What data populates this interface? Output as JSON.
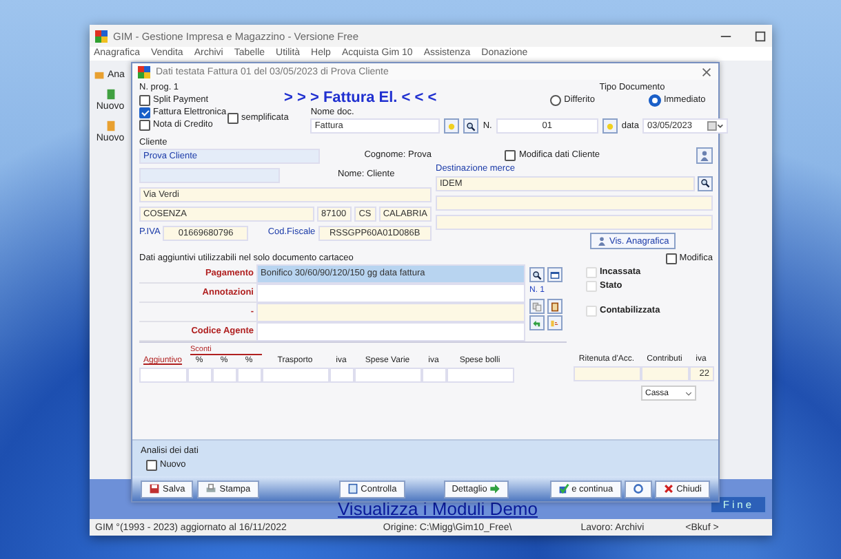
{
  "main_window": {
    "title": "GIM  - Gestione Impresa e Magazzino - Versione Free",
    "menu": [
      "Anagrafica",
      "Vendita",
      "Archivi",
      "Tabelle",
      "Utilità",
      "Help",
      "Acquista Gim 10",
      "Assistenza",
      "Donazione"
    ],
    "toolbar": [
      "Ana",
      "Nuovo",
      "Nuovo"
    ],
    "demo_link": "Visualizza i Moduli Demo",
    "fine_button": "Fine",
    "status_bar": [
      "GIM °(1993 - 2023)  aggiornato al 16/11/2022",
      "Origine: C:\\Migg\\Gim10_Free\\",
      "Lavoro:  Archivi",
      "<Bkuf >"
    ]
  },
  "dialog": {
    "title": "Dati testata Fattura 01 del 03/05/2023 di Prova Cliente",
    "prog": "N. prog. 1",
    "heading": "> > > Fattura El. < < <",
    "options": [
      {
        "label": "Split Payment",
        "checked": false
      },
      {
        "label": "Fattura Elettronica",
        "checked": true
      },
      {
        "label": "Nota di Credito",
        "checked": false
      }
    ],
    "semplificata": {
      "label": "semplificata",
      "checked": false
    },
    "tipo_documento": {
      "label": "Tipo Documento",
      "options": [
        {
          "label": "Differito",
          "selected": false
        },
        {
          "label": "Immediato",
          "selected": true
        }
      ]
    },
    "nome_doc": {
      "label": "Nome doc.",
      "value": "Fattura"
    },
    "numero": {
      "label": "N.",
      "value": "01"
    },
    "data": {
      "label": "data",
      "value": "03/05/2023"
    },
    "cliente": {
      "label": "Cliente",
      "name": "Prova Cliente",
      "cognome": "Cognome: Prova",
      "nome": "Nome: Cliente",
      "modifica": {
        "label": "Modifica dati Cliente",
        "checked": false
      },
      "address": "Via Verdi",
      "city": "COSENZA",
      "cap": "87100",
      "province": "CS",
      "region": "CALABRIA",
      "piva_label": "P.IVA",
      "piva": "01669680796",
      "cf_label": "Cod.Fiscale",
      "cf": "RSSGPP60A01D086B",
      "vis_button": "Vis. Anagrafica"
    },
    "destinazione": {
      "label": "Destinazione merce",
      "value": "IDEM"
    },
    "extra": {
      "caption": "Dati aggiuntivi utilizzabili nel solo documento cartaceo",
      "modifica": {
        "label": "Modifica",
        "checked": false
      },
      "fields": [
        {
          "label": "Pagamento",
          "value": "Bonifico 30/60/90/120/150 gg data fattura",
          "kind": "highlighted"
        },
        {
          "label": "Annotazioni",
          "kind": "plain"
        },
        {
          "label": "-",
          "kind": "tinted"
        },
        {
          "label": "Codice Agente",
          "kind": "plain"
        }
      ],
      "note_count": "N. 1",
      "flags": [
        {
          "label": "Incassata",
          "checked": false
        },
        {
          "label": "Stato",
          "checked": false
        },
        {
          "label": "Contabilizzata",
          "checked": false
        }
      ]
    },
    "charges": {
      "sconti_label": "Sconti",
      "columns": [
        {
          "label": "Aggiuntivo",
          "kind": "link"
        },
        {
          "label": "%",
          "kind": "narrow"
        },
        {
          "label": "%",
          "kind": "narrow"
        },
        {
          "label": "%",
          "kind": "narrow"
        },
        {
          "label": "Trasporto",
          "kind": "wide"
        },
        {
          "label": "iva",
          "kind": "narrow"
        },
        {
          "label": "Spese Varie",
          "kind": "wide"
        },
        {
          "label": "iva",
          "kind": "narrow"
        },
        {
          "label": "Spese bolli",
          "kind": "wide"
        }
      ],
      "right_columns": [
        {
          "label": "Ritenuta d'Acc.",
          "kind": "wide"
        },
        {
          "label": "Contributi",
          "kind": "mid"
        },
        {
          "label": "iva",
          "kind": "narrow",
          "value": "22"
        }
      ],
      "payment_method": "Cassa"
    },
    "analysis": {
      "label": "Analisi dei dati",
      "nuovo": {
        "label": "Nuovo",
        "checked": false
      }
    },
    "buttons": [
      {
        "label": "Salva",
        "kind": "text"
      },
      {
        "label": "Stampa",
        "kind": "text"
      },
      {
        "label": "Controlla",
        "kind": "text"
      },
      {
        "label": "Dettaglio",
        "kind": "text"
      },
      {
        "label": "e continua",
        "kind": "text"
      },
      {
        "kind": "icon"
      },
      {
        "label": "Chiudi",
        "kind": "text"
      }
    ]
  }
}
